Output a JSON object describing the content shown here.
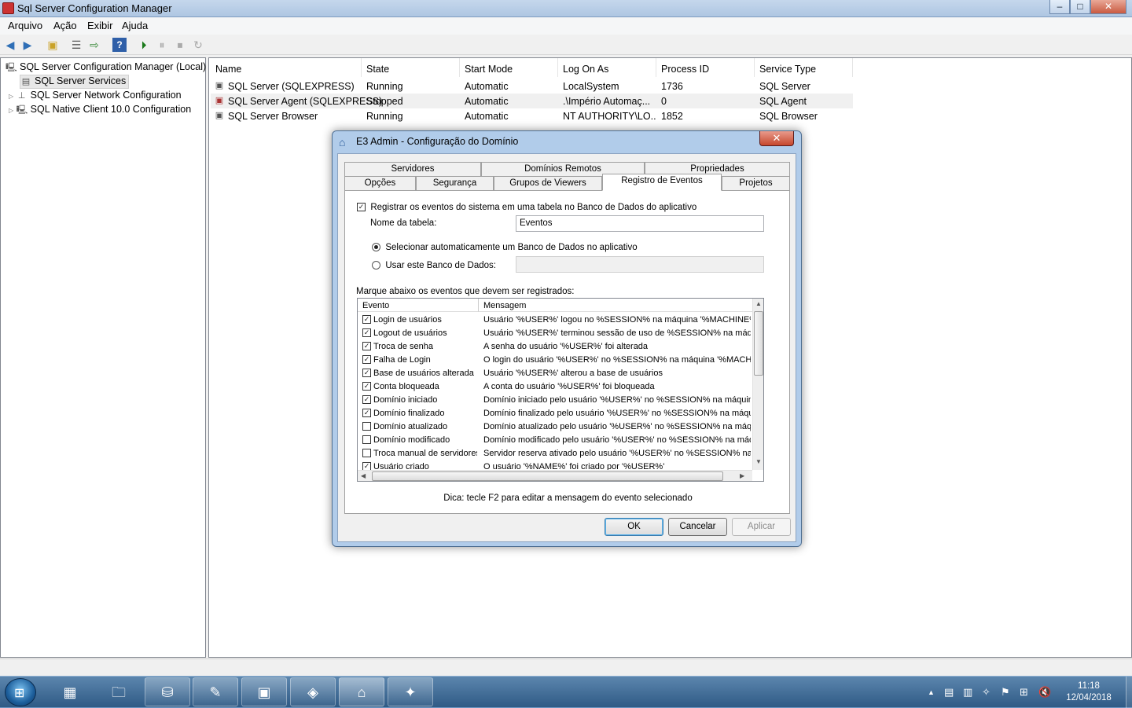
{
  "window": {
    "title": "Sql Server Configuration Manager",
    "minimize": "‒",
    "maximize": "□",
    "close": "✕"
  },
  "menu": [
    "Arquivo",
    "Ação",
    "Exibir",
    "Ajuda"
  ],
  "toolbar_icons": [
    "back-arrow-icon",
    "forward-arrow-icon",
    "up-folder-icon",
    "properties-icon",
    "export-icon",
    "help-icon",
    "start-service-icon",
    "pause-service-icon",
    "stop-service-icon",
    "restart-service-icon"
  ],
  "tree": {
    "root": "SQL Server Configuration Manager (Local)",
    "items": [
      {
        "label": "SQL Server Services",
        "selected": true
      },
      {
        "label": "SQL Server Network Configuration"
      },
      {
        "label": "SQL Native Client 10.0 Configuration"
      }
    ]
  },
  "services": {
    "columns": [
      "Name",
      "State",
      "Start Mode",
      "Log On As",
      "Process ID",
      "Service Type"
    ],
    "rows": [
      [
        "SQL Server (SQLEXPRESS)",
        "Running",
        "Automatic",
        "LocalSystem",
        "1736",
        "SQL Server"
      ],
      [
        "SQL Server Agent (SQLEXPRESS)",
        "Stopped",
        "Automatic",
        ".\\Império Automaç...",
        "0",
        "SQL Agent"
      ],
      [
        "SQL Server Browser",
        "Running",
        "Automatic",
        "NT AUTHORITY\\LO...",
        "1852",
        "SQL Browser"
      ]
    ]
  },
  "dialog": {
    "title": "E3 Admin - Configuração do Domínio",
    "close": "✕",
    "tabs_row1": [
      "Servidores",
      "Domínios Remotos",
      "Propriedades"
    ],
    "tabs_row2": [
      "Opções",
      "Segurança",
      "Grupos de Viewers",
      "Registro de Eventos",
      "Projetos"
    ],
    "selected_tab": "Registro de Eventos",
    "log_checkbox": "Registrar os eventos do sistema em uma tabela no Banco de Dados do aplicativo",
    "table_name_label": "Nome da tabela:",
    "table_name_value": "Eventos",
    "radio_auto": "Selecionar automaticamente um Banco de Dados no aplicativo",
    "radio_manual": "Usar este Banco de Dados:",
    "manual_db_value": "",
    "events_label": "Marque abaixo os eventos que devem ser registrados:",
    "event_columns": [
      "Evento",
      "Mensagem"
    ],
    "events": [
      {
        "checked": true,
        "name": "Login de usuários",
        "message": "Usuário '%USER%' logou no %SESSION% na máquina '%MACHINE%'"
      },
      {
        "checked": true,
        "name": "Logout de usuários",
        "message": "Usuário '%USER%' terminou sessão de uso de %SESSION% na máqui..."
      },
      {
        "checked": true,
        "name": "Troca de senha",
        "message": "A senha do usuário '%USER%' foi alterada"
      },
      {
        "checked": true,
        "name": "Falha de Login",
        "message": "O login do usuário '%USER%' no %SESSION% na máquina '%MACHI..."
      },
      {
        "checked": true,
        "name": "Base de usuários alterada",
        "message": "Usuário '%USER%' alterou a base de usuários"
      },
      {
        "checked": true,
        "name": "Conta bloqueada",
        "message": "A conta do usuário '%USER%' foi bloqueada"
      },
      {
        "checked": true,
        "name": "Domínio iniciado",
        "message": "Domínio iniciado pelo usuário '%USER%' no %SESSION% na máquina '"
      },
      {
        "checked": true,
        "name": "Domínio finalizado",
        "message": "Domínio finalizado pelo usuário '%USER%' no %SESSION% na máquin..."
      },
      {
        "checked": false,
        "name": "Domínio atualizado",
        "message": "Domínio atualizado pelo usuário '%USER%' no %SESSION% na máqui..."
      },
      {
        "checked": false,
        "name": "Domínio modificado",
        "message": "Domínio modificado pelo usuário '%USER%' no %SESSION% na máqui..."
      },
      {
        "checked": false,
        "name": "Troca manual de servidores",
        "message": "Servidor reserva ativado pelo usuário '%USER%' no %SESSION% na ..."
      },
      {
        "checked": true,
        "name": "Usuário criado",
        "message": "O usuário '%NAME%' foi criado por '%USER%'"
      }
    ],
    "hint": "Dica: tecle F2 para editar a mensagem do evento selecionado",
    "ok": "OK",
    "cancel": "Cancelar",
    "apply": "Aplicar"
  },
  "taskbar": {
    "apps": [
      "calculator-icon",
      "explorer-folder-icon",
      "sql-config-manager-icon",
      "notepad-icon",
      "terminal-monitor-icon",
      "package-icon",
      "e3-admin-icon",
      "paint-icon"
    ],
    "time": "11:18",
    "date": "12/04/2018"
  }
}
